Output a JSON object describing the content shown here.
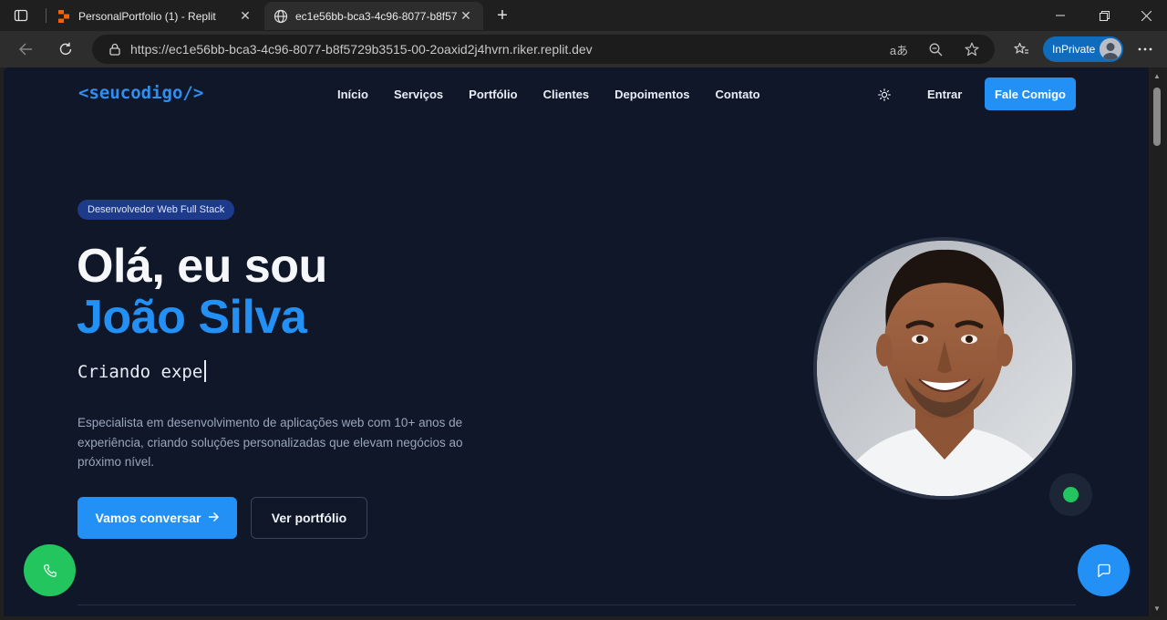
{
  "browser": {
    "tabs": [
      {
        "title": "PersonalPortfolio (1) - Replit",
        "active": false
      },
      {
        "title": "ec1e56bb-bca3-4c96-8077-b8f57",
        "active": true
      }
    ],
    "url": "https://ec1e56bb-bca3-4c96-8077-b8f5729b3515-00-2oaxid2j4hvrn.riker.replit.dev",
    "inprivate_label": "InPrivate",
    "read_aloud_glyph": "aあ"
  },
  "site": {
    "logo": "<seucodigo/>",
    "nav": [
      "Início",
      "Serviços",
      "Portfólio",
      "Clientes",
      "Depoimentos",
      "Contato"
    ],
    "login": "Entrar",
    "cta": "Fale Comigo"
  },
  "hero": {
    "badge": "Desenvolvedor Web Full Stack",
    "greeting": "Olá, eu sou",
    "name": "João Silva",
    "typing": "Criando expe",
    "description": "Especialista em desenvolvimento de aplicações web com 10+ anos de experiência, criando soluções personalizadas que elevam negócios ao próximo nível.",
    "primary_button": "Vamos conversar",
    "secondary_button": "Ver portfólio"
  },
  "colors": {
    "accent": "#2390f5",
    "page_bg": "#0f1729",
    "status_online": "#22c55e"
  }
}
